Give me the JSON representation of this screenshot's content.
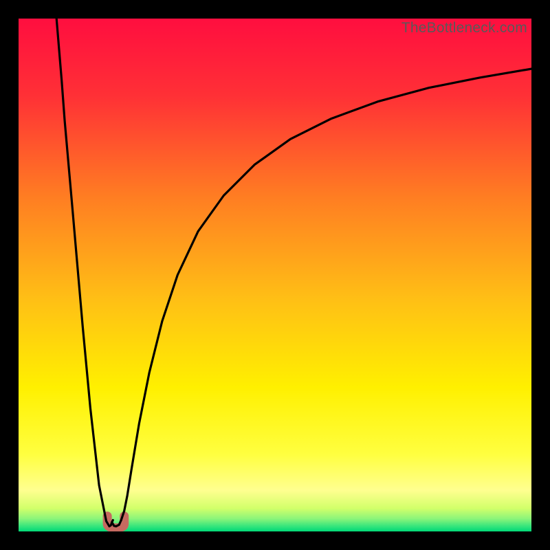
{
  "watermark": "TheBottleneck.com",
  "chart_data": {
    "type": "line",
    "title": "",
    "xlabel": "",
    "ylabel": "",
    "xlim": [
      0,
      100
    ],
    "ylim": [
      0,
      100
    ],
    "series": [
      {
        "name": "left-branch",
        "x": [
          7.4,
          8.4,
          9.0,
          10.5,
          12.5,
          14.0,
          15.7,
          17.1,
          17.7,
          18.0,
          18.2,
          18.4
        ],
        "y": [
          100,
          88,
          80,
          63,
          40,
          24,
          9,
          2.0,
          1.0,
          1.2,
          1.8,
          2.2
        ]
      },
      {
        "name": "dip-bottom",
        "x": [
          18.2,
          18.6,
          19.0,
          19.6,
          20.0
        ],
        "y": [
          1.8,
          1.1,
          1.0,
          1.3,
          2.2
        ]
      },
      {
        "name": "right-branch",
        "x": [
          20.0,
          20.6,
          21.2,
          22.0,
          23.5,
          25.5,
          28.0,
          31.0,
          35.0,
          40.0,
          46.0,
          53.0,
          61.0,
          70.0,
          80.0,
          90.0,
          100.0
        ],
        "y": [
          2.2,
          4.0,
          7.0,
          12.0,
          21.0,
          31.0,
          41.0,
          50.0,
          58.5,
          65.5,
          71.5,
          76.5,
          80.5,
          83.8,
          86.5,
          88.5,
          90.2
        ]
      }
    ],
    "marker": {
      "name": "minimum-marker",
      "x_range": [
        17.3,
        20.6
      ],
      "y_range": [
        0.7,
        3.0
      ],
      "color": "#c66a60"
    },
    "background": {
      "type": "vertical-gradient",
      "stops": [
        {
          "pos": 0.0,
          "color": "#ff0e3f"
        },
        {
          "pos": 0.15,
          "color": "#ff3036"
        },
        {
          "pos": 0.35,
          "color": "#ff7e22"
        },
        {
          "pos": 0.55,
          "color": "#ffc015"
        },
        {
          "pos": 0.72,
          "color": "#fff000"
        },
        {
          "pos": 0.85,
          "color": "#ffff40"
        },
        {
          "pos": 0.92,
          "color": "#ffff90"
        },
        {
          "pos": 0.955,
          "color": "#d2ff6a"
        },
        {
          "pos": 0.975,
          "color": "#8cf57a"
        },
        {
          "pos": 0.99,
          "color": "#35e57c"
        },
        {
          "pos": 1.0,
          "color": "#00d977"
        }
      ]
    }
  }
}
